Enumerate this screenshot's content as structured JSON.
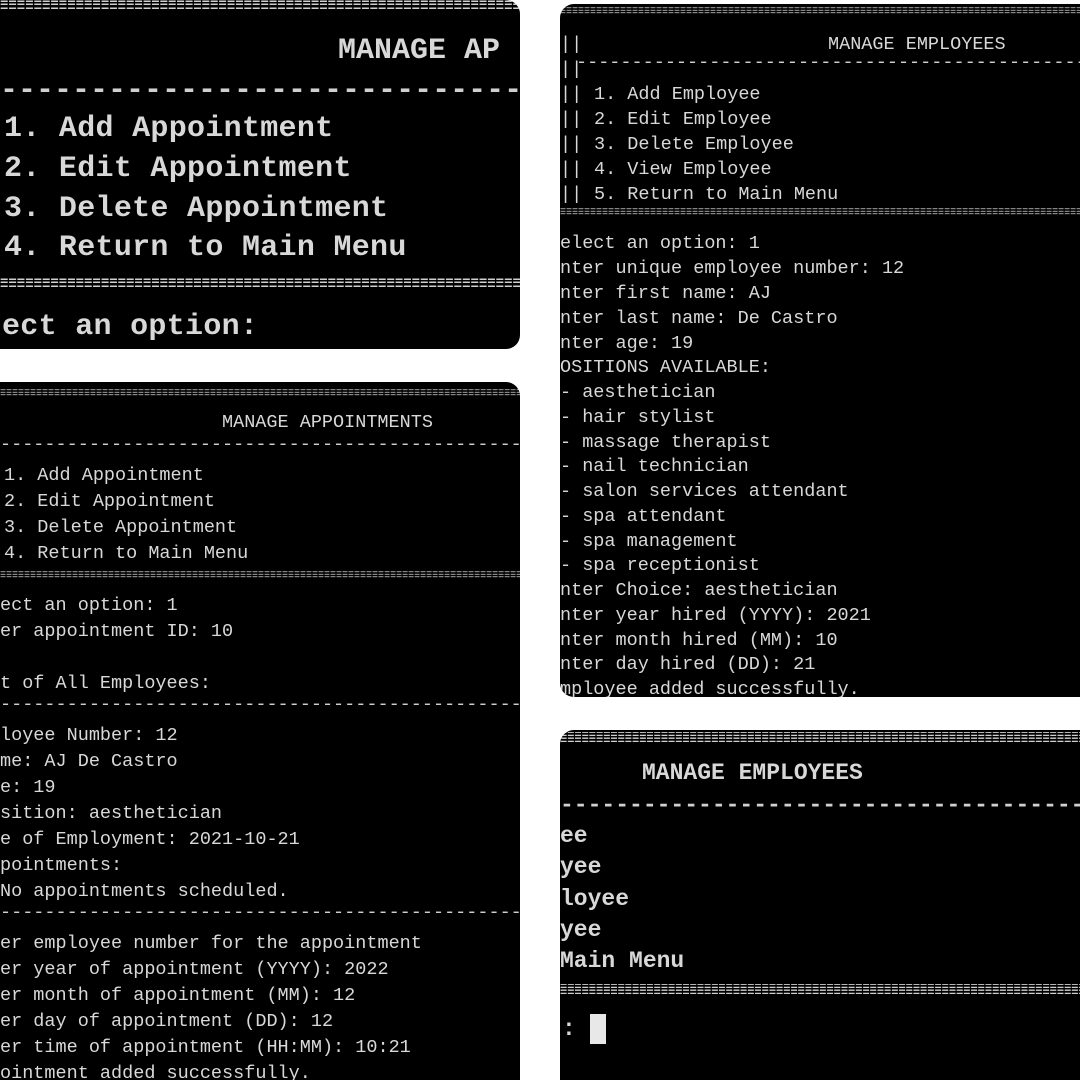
{
  "panel_a": {
    "title": "MANAGE AP",
    "menu": [
      "1. Add Appointment",
      "2. Edit Appointment",
      "3. Delete Appointment",
      "4. Return to Main Menu"
    ],
    "prompt": "ect an option:"
  },
  "panel_b": {
    "title": "MANAGE APPOINTMENTS",
    "menu": [
      "1. Add Appointment",
      "2. Edit Appointment",
      "3. Delete Appointment",
      "4. Return to Main Menu"
    ],
    "lines_1": [
      "ect an option: 1",
      "er appointment ID: 10",
      "",
      "t of All Employees:"
    ],
    "lines_2": [
      "loyee Number: 12",
      "me: AJ De Castro",
      "e: 19",
      "sition: aesthetician",
      "e of Employment: 2021-10-21",
      "pointments:",
      "No appointments scheduled."
    ],
    "lines_3": [
      "er employee number for the appointment",
      "er year of appointment (YYYY): 2022",
      "er month of appointment (MM): 12",
      "er day of appointment (DD): 12",
      "er time of appointment (HH:MM): 10:21",
      "ointment added successfully."
    ]
  },
  "panel_c": {
    "title": "MANAGE EMPLOYEES",
    "border_prefix": "||",
    "menu": [
      "1. Add Employee",
      "2. Edit Employee",
      "3. Delete Employee",
      "4. View Employee",
      "5. Return to Main Menu"
    ],
    "lines": [
      "elect an option: 1",
      "nter unique employee number: 12",
      "nter first name: AJ",
      "nter last name: De Castro",
      "nter age: 19",
      "OSITIONS AVAILABLE:",
      "- aesthetician",
      "- hair stylist",
      "- massage therapist",
      "- nail technician",
      "- salon services attendant",
      "- spa attendant",
      "- spa management",
      "- spa receptionist",
      "nter Choice: aesthetician",
      "nter year hired (YYYY): 2021",
      "nter month hired (MM): 10",
      "nter day hired (DD): 21",
      "mployee added successfully."
    ]
  },
  "panel_d": {
    "title": "MANAGE EMPLOYEES",
    "menu": [
      "ee",
      "yee",
      "loyee",
      "yee",
      "Main Menu"
    ],
    "prompt": ":"
  }
}
